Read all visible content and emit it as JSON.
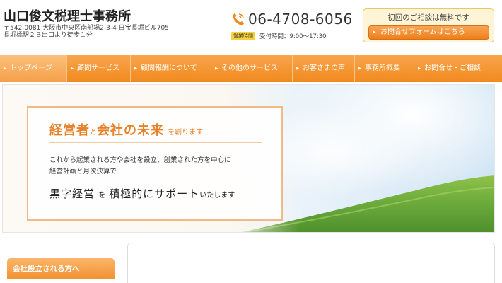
{
  "header": {
    "site_title": "山口俊文税理士事務所",
    "address_line1": "〒542-0081 大阪市中央区南船場2-3-4 日宝長堀ビル705",
    "address_line2": "長堀橋駅２Ｂ出口より徒歩１分",
    "phone": "06-4708-6056",
    "hours_badge": "営業時間",
    "hours_text": "受付時間：9:00～17:30",
    "consult_title": "初回のご相談は無料です",
    "consult_button": "お問合せフォームはこちら"
  },
  "nav": {
    "items": [
      {
        "label": "トップページ"
      },
      {
        "label": "顧問サービス"
      },
      {
        "label": "顧問報酬について"
      },
      {
        "label": "その他のサービス"
      },
      {
        "label": "お客さまの声"
      },
      {
        "label": "事務所概要"
      },
      {
        "label": "お問合せ・ご相談"
      }
    ]
  },
  "hero": {
    "headline_1": "経営者",
    "headline_and": "と",
    "headline_2": "会社の未来",
    "headline_suffix": "を創ります",
    "body_line1": "これから起業される方や会社を設立、創業された方を中心に",
    "body_line2": "経営計画と月次決算で",
    "tag_1": "黒字経営",
    "tag_wo": "を",
    "tag_2": "積極的にサポート",
    "tag_suffix": "いたします"
  },
  "sidebar": {
    "heading": "会社設立される方へ"
  },
  "icons": {
    "phone": "phone-icon"
  },
  "colors": {
    "accent": "#f08a1e",
    "headline": "#e8822a",
    "badge": "#f5d23c"
  }
}
